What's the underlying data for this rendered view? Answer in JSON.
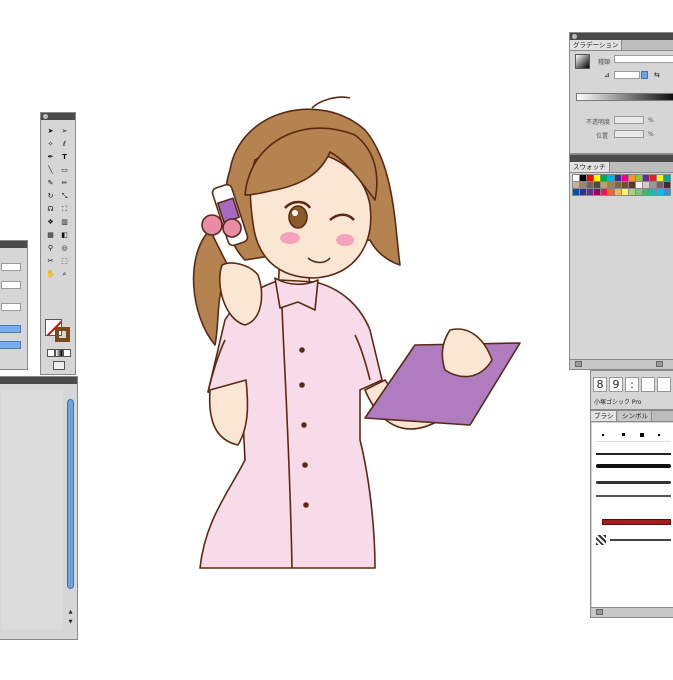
{
  "gradient_panel": {
    "tab": "グラデーション",
    "type_label": "種類",
    "opacity_label": "不透明度",
    "location_label": "位置",
    "percent": "%"
  },
  "swatch_panel": {
    "tab": "スウォッチ",
    "swatches": [
      "#ffffff",
      "#000000",
      "#ff0000",
      "#ffff00",
      "#00a651",
      "#00aeef",
      "#2e3192",
      "#ec008c",
      "#f7941d",
      "#8dc63f",
      "#662d91",
      "#ed1c24",
      "#fff200",
      "#00a99d",
      "#c7b299",
      "#998675",
      "#736357",
      "#534741",
      "#c69c6d",
      "#a67c52",
      "#8c6239",
      "#754c24",
      "#603913",
      "#f2f2f2",
      "#cccccc",
      "#999999",
      "#666666",
      "#333333",
      "#0054a6",
      "#2e3192",
      "#662d91",
      "#9e005d",
      "#ed145b",
      "#f26522",
      "#fbaf5d",
      "#fff568",
      "#acd373",
      "#7cc576",
      "#3bb878",
      "#1abbb4",
      "#00bff3",
      "#448ccb"
    ]
  },
  "glyph_panel": {
    "chars": [
      "8",
      "9",
      ":"
    ],
    "font": "小塚ゴシック Pro"
  },
  "brush_panel": {
    "tab_brush": "ブラシ",
    "tab_symbol": "シンボル"
  },
  "colors": {
    "panel_bg": "#d6d6d6",
    "titlebar": "#4a4a4a",
    "scrollbar_blue": "#6fa3e0",
    "skin": "#fbe6d4",
    "hair": "#b5834f",
    "uniform": "#f7dbe8",
    "clipboard": "#b07cbf",
    "outline": "#5a2a14"
  },
  "icons": [
    "selection-tool-icon",
    "direct-selection-tool-icon",
    "magic-wand-icon",
    "lasso-icon",
    "pen-tool-icon",
    "type-tool-icon",
    "line-tool-icon",
    "rectangle-tool-icon",
    "paintbrush-icon",
    "pencil-icon",
    "rotate-icon",
    "scale-icon",
    "warp-icon",
    "free-transform-icon",
    "symbol-sprayer-icon",
    "graph-icon",
    "mesh-icon",
    "gradient-icon",
    "eyedropper-icon",
    "blend-icon",
    "scissors-icon",
    "artboard-icon",
    "hand-icon",
    "zoom-icon"
  ]
}
